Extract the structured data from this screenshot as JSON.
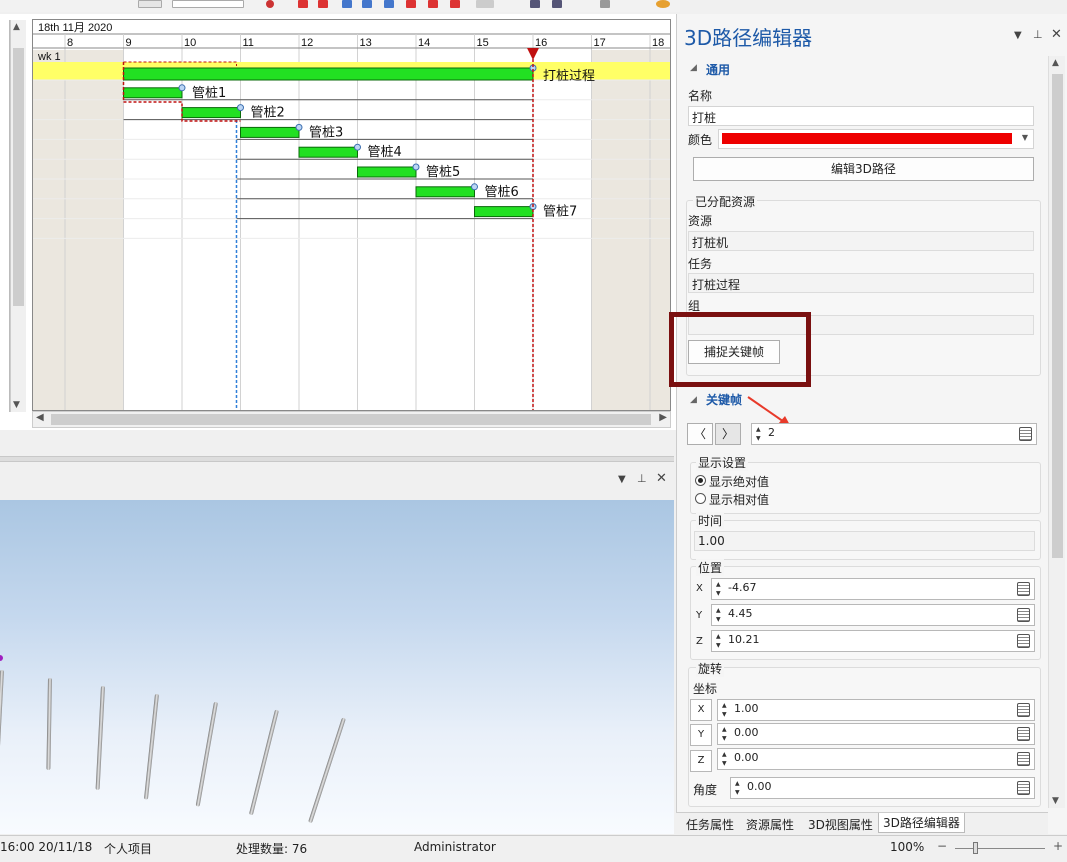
{
  "gantt": {
    "date_header": "18th 11月 2020",
    "day_labels": [
      "8",
      "9",
      "10",
      "11",
      "12",
      "13",
      "14",
      "15",
      "16",
      "17",
      "18"
    ],
    "week_label": "wk 1",
    "rows": [
      {
        "label": "打桩过程",
        "start": 9,
        "end": 16
      },
      {
        "label": "管桩1",
        "start": 9,
        "end": 10
      },
      {
        "label": "管桩2",
        "start": 10,
        "end": 11
      },
      {
        "label": "管桩3",
        "start": 11,
        "end": 12
      },
      {
        "label": "管桩4",
        "start": 12,
        "end": 13
      },
      {
        "label": "管桩5",
        "start": 13,
        "end": 14
      },
      {
        "label": "管桩6",
        "start": 14,
        "end": 15
      },
      {
        "label": "管桩7",
        "start": 15,
        "end": 16
      }
    ]
  },
  "status": {
    "time": "16:00 20/11/18",
    "project": "个人项目",
    "count": "处理数量: 76",
    "user": "Administrator",
    "zoom": "100%"
  },
  "panel": {
    "title": "3D路径编辑器",
    "general_section": "通用",
    "name_label": "名称",
    "name_value": "打桩",
    "color_label": "颜色",
    "color_value": "#ee0000",
    "edit_path_button": "编辑3D路径",
    "assigned_group": "已分配资源",
    "resource_label": "资源",
    "resource_value": "打桩机",
    "task_label": "任务",
    "task_value": "打桩过程",
    "group_label": "组",
    "group_value": "",
    "capture_button": "捕捉关键帧",
    "keyframe_section": "关键帧",
    "keyframe_value": "2",
    "display_group": "显示设置",
    "radio_absolute": "显示绝对值",
    "radio_relative": "显示相对值",
    "time_group": "时间",
    "time_value": "1.00",
    "position_group": "位置",
    "pos_x": "-4.67",
    "pos_y": "4.45",
    "pos_z": "10.21",
    "rotation_group": "旋转",
    "coord_label": "坐标",
    "rot_x": "1.00",
    "rot_y": "0.00",
    "rot_z": "0.00",
    "angle_label": "角度",
    "angle_value": "0.00",
    "tabs": [
      "任务属性",
      "资源属性",
      "3D视图属性",
      "3D路径编辑器"
    ]
  }
}
